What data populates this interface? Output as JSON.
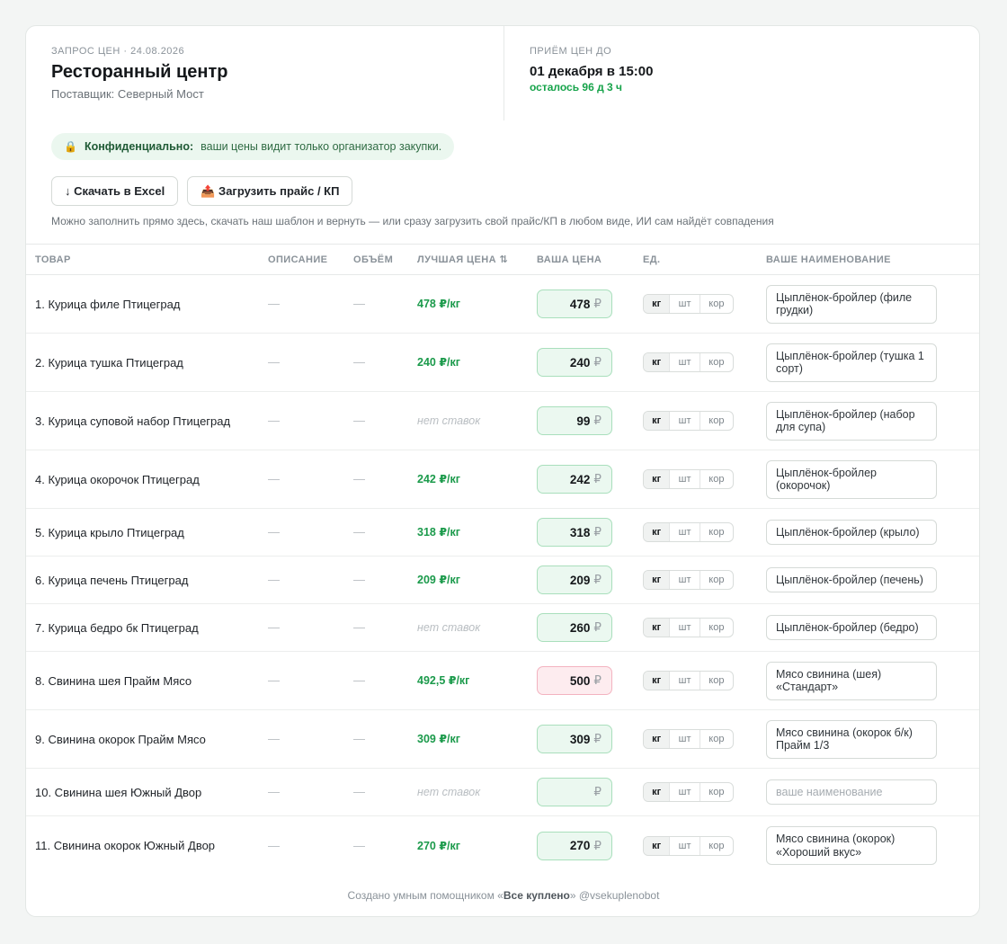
{
  "header": {
    "eyebrow": "ЗАПРОС ЦЕН · 24.08.2026",
    "title": "Ресторанный центр",
    "supplier": "Поставщик: Северный Мост",
    "deadline_label": "ПРИЁМ ЦЕН ДО",
    "deadline": "01 декабря в 15:00",
    "remaining": "осталось 96 д 3 ч"
  },
  "confidential": {
    "icon": "lock-icon",
    "label": "Конфиденциально:",
    "text": "ваши цены видит только организатор закупки."
  },
  "actions": {
    "download_label": "↓ Скачать в Excel",
    "upload_label": "📤 Загрузить прайс / КП",
    "hint": "Можно заполнить прямо здесь, скачать наш шаблон и вернуть — или сразу загрузить свой прайс/КП в любом виде, ИИ сам найдёт совпадения"
  },
  "columns": {
    "product": "ТОВАР",
    "description": "ОПИСАНИЕ",
    "volume": "ОБЪЁМ",
    "best_price": "ЛУЧШАЯ ЦЕНА ⇅",
    "your_price": "ВАША ЦЕНА",
    "unit": "ЕД.",
    "your_name": "ВАШЕ НАИМЕНОВАНИЕ"
  },
  "units": [
    "кг",
    "шт",
    "кор"
  ],
  "currency": "₽",
  "name_placeholder": "ваше наименование",
  "rows": [
    {
      "product": "1. Курица филе Птицеград",
      "description": "—",
      "volume": "—",
      "best": "478 ₽/кг",
      "best_none": false,
      "price": "478",
      "price_high": false,
      "unit": "кг",
      "name": "Цыплёнок-бройлер (филе грудки)"
    },
    {
      "product": "2. Курица тушка Птицеград",
      "description": "—",
      "volume": "—",
      "best": "240 ₽/кг",
      "best_none": false,
      "price": "240",
      "price_high": false,
      "unit": "кг",
      "name": "Цыплёнок-бройлер (тушка 1 сорт)"
    },
    {
      "product": "3. Курица суповой набор Птицеград",
      "description": "—",
      "volume": "—",
      "best": "нет ставок",
      "best_none": true,
      "price": "99",
      "price_high": false,
      "unit": "кг",
      "name": "Цыплёнок-бройлер (набор для супа)"
    },
    {
      "product": "4. Курица окорочок Птицеград",
      "description": "—",
      "volume": "—",
      "best": "242 ₽/кг",
      "best_none": false,
      "price": "242",
      "price_high": false,
      "unit": "кг",
      "name": "Цыплёнок-бройлер (окорочок)"
    },
    {
      "product": "5. Курица крыло Птицеград",
      "description": "—",
      "volume": "—",
      "best": "318 ₽/кг",
      "best_none": false,
      "price": "318",
      "price_high": false,
      "unit": "кг",
      "name": "Цыплёнок-бройлер (крыло)"
    },
    {
      "product": "6. Курица печень Птицеград",
      "description": "—",
      "volume": "—",
      "best": "209 ₽/кг",
      "best_none": false,
      "price": "209",
      "price_high": false,
      "unit": "кг",
      "name": "Цыплёнок-бройлер (печень)"
    },
    {
      "product": "7. Курица бедро бк Птицеград",
      "description": "—",
      "volume": "—",
      "best": "нет ставок",
      "best_none": true,
      "price": "260",
      "price_high": false,
      "unit": "кг",
      "name": "Цыплёнок-бройлер (бедро)"
    },
    {
      "product": "8. Свинина шея Прайм Мясо",
      "description": "—",
      "volume": "—",
      "best": "492,5 ₽/кг",
      "best_none": false,
      "price": "500",
      "price_high": true,
      "unit": "кг",
      "name": "Мясо свинина (шея) «Стандарт»"
    },
    {
      "product": "9. Свинина окорок Прайм Мясо",
      "description": "—",
      "volume": "—",
      "best": "309 ₽/кг",
      "best_none": false,
      "price": "309",
      "price_high": false,
      "unit": "кг",
      "name": "Мясо свинина (окорок б/к) Прайм 1/3"
    },
    {
      "product": "10. Свинина шея Южный Двор",
      "description": "—",
      "volume": "—",
      "best": "нет ставок",
      "best_none": true,
      "price": "",
      "price_high": false,
      "unit": "кг",
      "name": ""
    },
    {
      "product": "11. Свинина окорок Южный Двор",
      "description": "—",
      "volume": "—",
      "best": "270 ₽/кг",
      "best_none": false,
      "price": "270",
      "price_high": false,
      "unit": "кг",
      "name": "Мясо свинина (окорок) «Хороший вкус»"
    }
  ],
  "footer": {
    "prefix": "Создано умным помощником «",
    "brand": "Все куплено",
    "suffix": "» @vsekuplenobot"
  },
  "colors": {
    "accent_green": "#1b9a4b",
    "price_ok_bg": "#ebf8f0",
    "price_high_bg": "#fdecef"
  }
}
